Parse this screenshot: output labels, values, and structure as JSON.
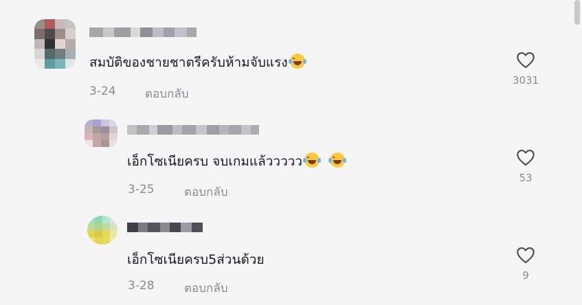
{
  "comments": [
    {
      "text": "สมบัติของชายชาตรีครับห้ามจับแรง",
      "emojis": [
        "face-with-tears-of-joy"
      ],
      "date": "3-24",
      "reply_label": "ตอบกลับ",
      "likes": "3031"
    },
    {
      "text": "เอ็กโซเนียครบ จบเกมแล้ววววว",
      "emojis": [
        "face-with-tears-of-joy",
        "face-with-tears-of-joy"
      ],
      "date": "3-25",
      "reply_label": "ตอบกลับ",
      "likes": "53"
    },
    {
      "text": "เอ็กโซเนียครบ5ส่วนด้วย",
      "emojis": [],
      "date": "3-28",
      "reply_label": "ตอบกลับ",
      "likes": "9"
    }
  ],
  "colors": {
    "background": "#f5f5f5",
    "text": "#161823",
    "secondary": "#8a8b91",
    "emoji": "#ffc83d"
  },
  "icons": {
    "like": "heart-outline-icon",
    "emoji": "face-with-tears-of-joy"
  }
}
